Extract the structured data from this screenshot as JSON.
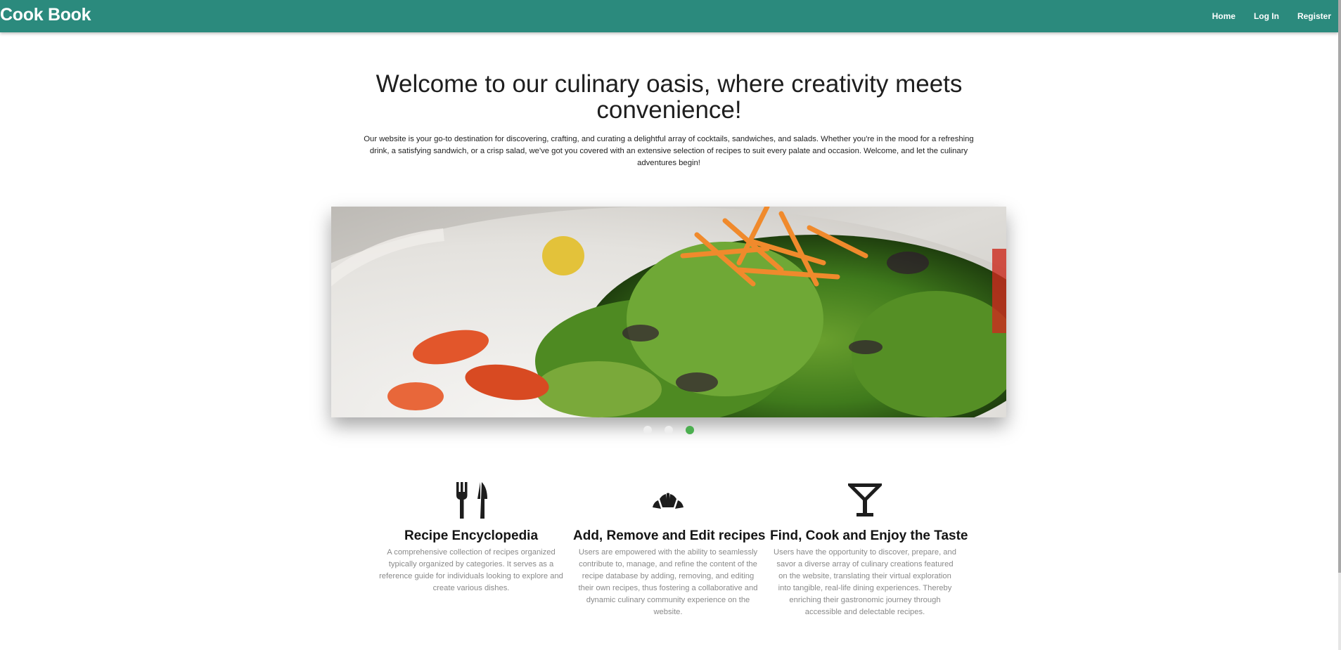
{
  "nav": {
    "brand": "Cook Book",
    "links": [
      {
        "label": "Home"
      },
      {
        "label": "Log In"
      },
      {
        "label": "Register"
      }
    ]
  },
  "hero": {
    "title": "Welcome to our culinary oasis, where creativity meets convenience!",
    "description": "Our website is your go-to destination for discovering, crafting, and curating a delightful array of cocktails, sandwiches, and salads. Whether you're in the mood for a refreshing drink, a satisfying sandwich, or a crisp salad, we've got you covered with an extensive selection of recipes to suit every palate and occasion. Welcome, and let the culinary adventures begin!"
  },
  "carousel": {
    "image": "salad-image",
    "active_index": 2,
    "slide_count": 3
  },
  "features": [
    {
      "icon": "cutlery-icon",
      "title": "Recipe Encyclopedia",
      "text": "A comprehensive collection of recipes organized typically organized by categories. It serves as a reference guide for individuals looking to explore and create various dishes."
    },
    {
      "icon": "croissant-icon",
      "title": "Add, Remove and Edit recipes",
      "text": "Users are empowered with the ability to seamlessly contribute to, manage, and refine the content of the recipe database by adding, removing, and editing their own recipes, thus fostering a collaborative and dynamic culinary community experience on the website."
    },
    {
      "icon": "cocktail-icon",
      "title": "Find, Cook and Enjoy the Taste",
      "text": "Users have the opportunity to discover, prepare, and savor a diverse array of culinary creations featured on the website, translating their virtual exploration into tangible, real-life dining experiences. Thereby enriching their gastronomic journey through accessible and delectable recipes."
    }
  ],
  "colors": {
    "navbar": "#2b8a7d",
    "dot_active": "#4caf50",
    "dot_inactive": "#eeeeee"
  }
}
